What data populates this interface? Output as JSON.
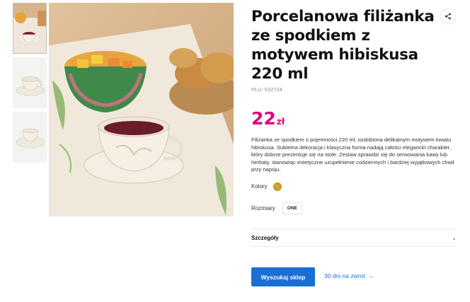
{
  "product": {
    "title": "Porcelanowa filiżanka ze spodkiem z motywem hibiskusa 220 ml",
    "plu": "PLU: 632724",
    "price": "22",
    "currency": "zł",
    "price_color": "#e4007c",
    "description": "Filiżanka ze spodkiem o pojemności 220 ml, ozdobiona delikatnym motywem kwiatu hibiskusa. Subtelna dekoracja i klasyczna forma nadają całości eleganckí charakter, który dobrze prezentuje się na stole. Zestaw sprawdzi się do serwowania kawy lub herbaty, stanowiąc estetyczne uzupełnienie codziennych i bardziej wyjątkowych chwil przy napoju."
  },
  "options": {
    "colors_label": "Kolory",
    "color_swatch": "#c8a72d",
    "sizes_label": "Rozmiary",
    "size_value": "ONE"
  },
  "details": {
    "label": "Szczegóły",
    "icon": "chevron-down-icon"
  },
  "actions": {
    "search_store_label": "Wyszukaj sklep",
    "return_label": "30 dni na zwrot",
    "return_arrow": "→",
    "accent": "#1a6fd6"
  },
  "gallery": {
    "thumbnail_count": 3,
    "active_index": 0
  },
  "share_icon": "share-icon"
}
